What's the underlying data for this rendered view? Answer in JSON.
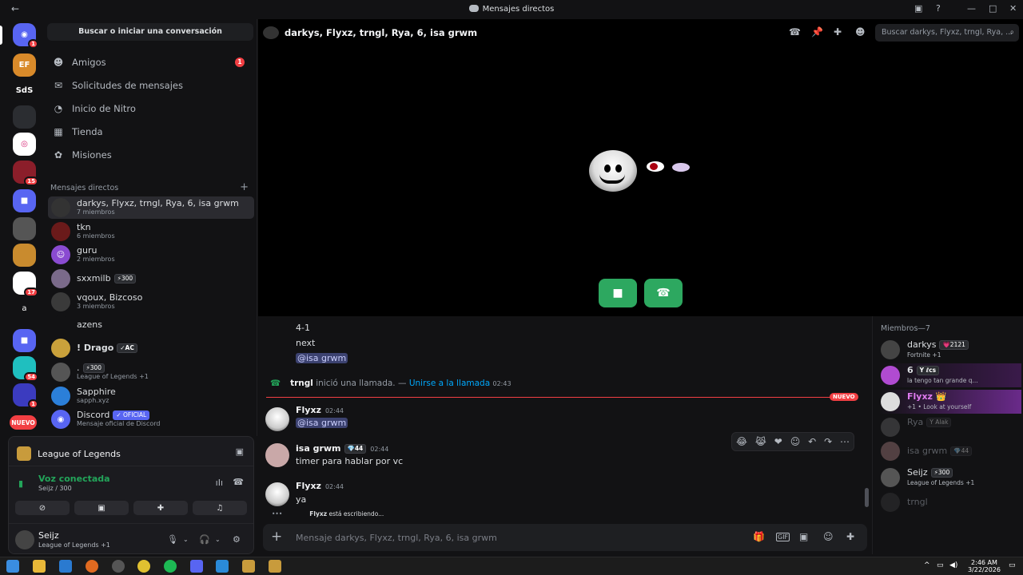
{
  "window": {
    "title": "Mensajes directos"
  },
  "servers": [
    {
      "label": "",
      "badge": "1",
      "color": "#5865f2"
    },
    {
      "label": "EF",
      "badge": "",
      "color": "#d98a2a"
    },
    {
      "label": "SdS",
      "badge": "",
      "color": "#121214"
    },
    {
      "label": "",
      "badge": "",
      "color": "#2b2d31"
    },
    {
      "label": "",
      "badge": "",
      "color": "#ffffff"
    },
    {
      "label": "",
      "badge": "15",
      "color": "#8b1e2a"
    },
    {
      "label": "",
      "badge": "",
      "color": "#5865f2"
    },
    {
      "label": "",
      "badge": "",
      "color": "#555"
    },
    {
      "label": "",
      "badge": "",
      "color": "#c98b2e"
    },
    {
      "label": "",
      "badge": "17",
      "color": "#ffffff"
    },
    {
      "label": "a",
      "badge": "",
      "color": "#121214"
    },
    {
      "label": "",
      "badge": "",
      "color": "#5865f2"
    },
    {
      "label": "",
      "badge": "54",
      "color": "#1fbfbf"
    },
    {
      "label": "",
      "badge": "1",
      "color": "#3b3bbf"
    },
    {
      "label": "NUEVO",
      "badge": "",
      "color": "#f23f43"
    }
  ],
  "sidebar": {
    "search_label": "Buscar o iniciar una conversación",
    "nav": [
      {
        "label": "Amigos",
        "icon": "friends-icon",
        "count": "1"
      },
      {
        "label": "Solicitudes de mensajes",
        "icon": "mail-icon",
        "count": ""
      },
      {
        "label": "Inicio de Nitro",
        "icon": "nitro-icon",
        "count": ""
      },
      {
        "label": "Tienda",
        "icon": "shop-icon",
        "count": ""
      },
      {
        "label": "Misiones",
        "icon": "quests-icon",
        "count": ""
      }
    ],
    "dm_header": "Mensajes directos",
    "dms": [
      {
        "name": "darkys, Flyxz, trngl, Rya, 6, isa grwm",
        "sub": "7 miembros",
        "tag": "",
        "color": "#333"
      },
      {
        "name": "tkn",
        "sub": "6 miembros",
        "tag": "",
        "color": "#6a1a1a"
      },
      {
        "name": "guru",
        "sub": "2 miembros",
        "tag": "",
        "color": "#8a4bd1"
      },
      {
        "name": "sxxmilb",
        "sub": "",
        "tag": "⚡300",
        "color": "#7a6a8a"
      },
      {
        "name": "vqoux, Bizcoso",
        "sub": "3 miembros",
        "tag": "",
        "color": "#3a3a3a"
      },
      {
        "name": "azens",
        "sub": "",
        "tag": "",
        "color": "#121214"
      },
      {
        "name": "! Drago",
        "sub": "",
        "tag": "✓AC",
        "color": "#c9a13b"
      },
      {
        "name": ".",
        "sub": "League of Legends +1",
        "tag": "⚡300",
        "color": "#555"
      },
      {
        "name": "Sapphire",
        "sub": "sapph.xyz",
        "tag": "",
        "color": "#2b7fd9"
      },
      {
        "name": "Discord",
        "sub": "Mensaje oficial de Discord",
        "tag": "✓ OFICIAL",
        "color": "#5865f2"
      }
    ]
  },
  "voice": {
    "game": "League of Legends",
    "status": "Voz conectada",
    "channel": "Seijz / 300"
  },
  "user": {
    "name": "Seijz",
    "status": "League of Legends +1"
  },
  "chat": {
    "title": "darkys, Flyxz, trngl, Rya, 6, isa grwm",
    "search_placeholder": "Buscar darkys, Flyxz, trngl, Rya, ...",
    "prev_lines": [
      "4-1",
      "next",
      "@isa grwm"
    ],
    "call_event": {
      "user": "trngl",
      "text": "inició una llamada. —",
      "link": "Unirse a la llamada",
      "time": "02:43"
    },
    "new_label": "NUEVO",
    "messages": [
      {
        "author": "Flyxz",
        "time": "02:44",
        "text": "@isa grwm",
        "mention": true
      },
      {
        "author": "isa grwm",
        "badge": "💎44",
        "time": "02:44",
        "text": "timer para hablar por vc"
      },
      {
        "author": "Flyxz",
        "time": "02:44",
        "text": "ya"
      }
    ],
    "typing_user": "Flyxz",
    "typing_text": "está escribiendo...",
    "composer_placeholder": "Mensaje darkys, Flyxz, trngl, Rya, 6, isa grwm"
  },
  "members": {
    "header": "Miembros—7",
    "list": [
      {
        "name": "darkys",
        "tag": "💗2121",
        "status": "Fortnite +1",
        "color": "#444",
        "offline": false
      },
      {
        "name": "6",
        "tag": "Y ℓcs",
        "status": "la tengo tan grande q...",
        "color": "#b04bd1",
        "offline": false
      },
      {
        "name": "Flyxz",
        "tag": "👑",
        "status": "+1 • Look at yourself",
        "color": "#ddd",
        "offline": false
      },
      {
        "name": "Rya",
        "tag": "Y Alak",
        "status": "",
        "color": "#777",
        "offline": true
      },
      {
        "name": "isa grwm",
        "tag": "💎44",
        "status": "",
        "color": "#c99",
        "offline": true
      },
      {
        "name": "Seijz",
        "tag": "⚡300",
        "status": "League of Legends +1",
        "color": "#555",
        "offline": false
      },
      {
        "name": "trngl",
        "tag": "",
        "status": "",
        "color": "#444",
        "offline": true
      }
    ]
  },
  "taskbar": {
    "time": "2:46 AM",
    "date": "3/22/2026"
  }
}
